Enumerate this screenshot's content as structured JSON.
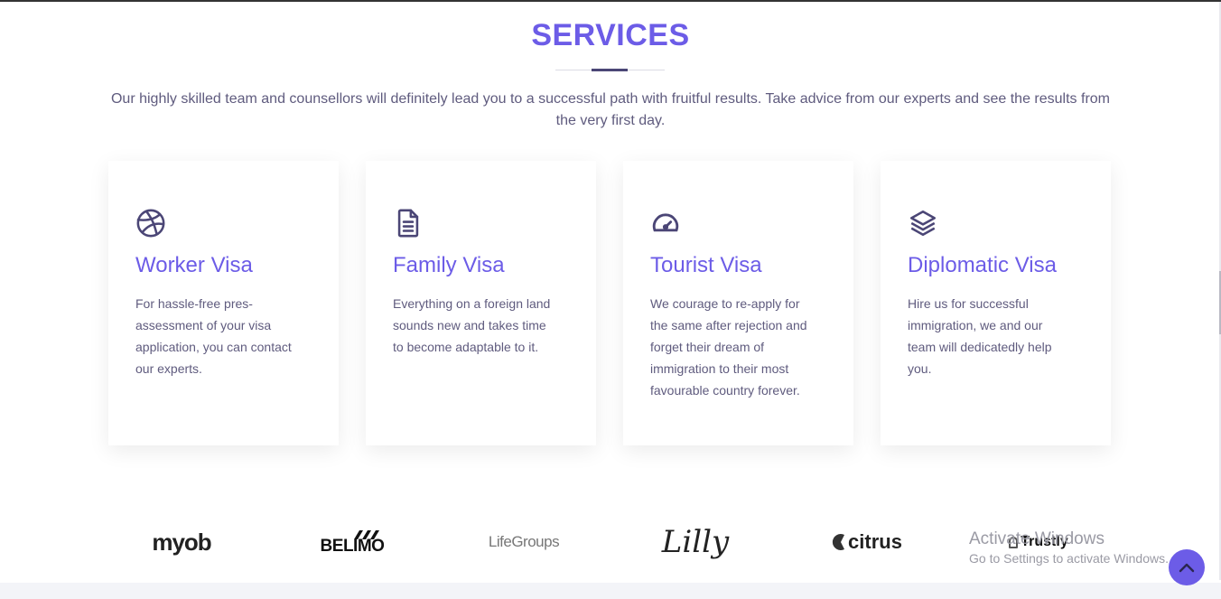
{
  "section": {
    "title": "SERVICES",
    "intro": "Our highly skilled team and counsellors will definitely lead you to a successful path with fruitful results. Take advice from our experts and see the results from the very first day."
  },
  "cards": [
    {
      "icon": "dribbble-icon",
      "title": "Worker Visa",
      "text": "For hassle-free pres-assessment of your visa application, you can contact our experts."
    },
    {
      "icon": "document-icon",
      "title": "Family Visa",
      "text": "Everything on a foreign land sounds new and takes time to become adaptable to it."
    },
    {
      "icon": "speedometer-icon",
      "title": "Tourist Visa",
      "text": "We courage to re-apply for the same after rejection and forget their dream of immigration to their most favourable country forever."
    },
    {
      "icon": "layers-icon",
      "title": "Diplomatic Visa",
      "text": "Hire us for successful immigration, we and our team will dedicatedly help you."
    }
  ],
  "logos": {
    "myob": "myob",
    "belimo": "BELIMO",
    "lifegroups": "LifeGroups",
    "lilly": "Lilly",
    "citrus": "citrus",
    "trustly": "Trustly"
  },
  "watermark": {
    "title": "Activate Windows",
    "subtitle": "Go to Settings to activate Windows."
  },
  "colors": {
    "accent": "#6c5ce7",
    "text": "#5f5b7e",
    "icon": "#4b4676"
  }
}
